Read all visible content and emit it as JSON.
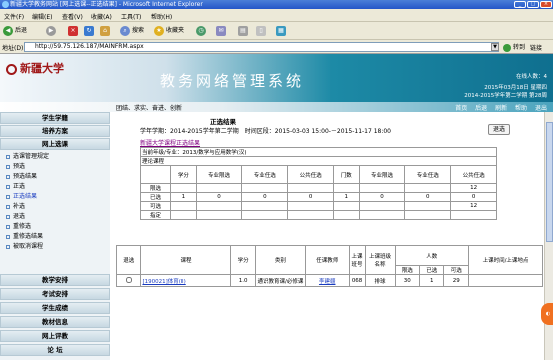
{
  "window": {
    "title": "新疆大学教务网站 [网上选课--正选结果] - Microsoft Internet Explorer"
  },
  "menu": [
    "文件(F)",
    "编辑(E)",
    "查看(V)",
    "收藏(A)",
    "工具(T)",
    "帮助(H)"
  ],
  "toolbar": {
    "back": "后退",
    "search": "搜索",
    "favorites": "收藏夹"
  },
  "address": {
    "label": "地址(D)",
    "url": "http://59.75.126.187/MAINFRM.aspx",
    "go": "转到",
    "links": "链接"
  },
  "banner": {
    "school": "新疆大学",
    "system_title": "教务网络管理系统",
    "online": "在线人数：4",
    "date": "2015年03月18日 星期四",
    "term": "2014-2015学年第二学期 第28周"
  },
  "slogan": "团结、求实、奋进、创新",
  "nav": [
    "首页",
    "后退",
    "刷新",
    "帮助",
    "退出"
  ],
  "sidebar": {
    "sections": [
      "学生学籍",
      "培养方案",
      "网上选课",
      "教学安排",
      "考试安排",
      "学生成绩",
      "教材信息",
      "网上评教",
      "论  坛"
    ],
    "items": [
      "选课管理规定",
      "预选",
      "预选结果",
      "正选",
      "正选结果",
      "补选",
      "退选",
      "重修选",
      "重修选结果",
      "被取消课程"
    ]
  },
  "main": {
    "heading": "正选结果",
    "term_line": "学年学期：2014-2015学年第二学期　时间区段：2015-03-03 15:00-－2015-11-17 18:00",
    "close_btn": "退选",
    "link": "新疆大学课程正选结果",
    "grade_line": "当前年级/专业：2013/数学与应用数学(汉)",
    "theory": "理论课程",
    "summary_headers": [
      "学分",
      "专业限选",
      "专业任选",
      "公共任选",
      "门数",
      "专业限选",
      "专业任选",
      "公共任选"
    ],
    "summary_rows": [
      {
        "label": "限选",
        "vals": [
          "",
          "",
          "",
          "",
          "",
          "",
          "",
          "12"
        ]
      },
      {
        "label": "已选",
        "vals": [
          "1",
          "0",
          "0",
          "0",
          "1",
          "0",
          "0",
          "0"
        ]
      },
      {
        "label": "可选",
        "vals": [
          "",
          "",
          "",
          "",
          "",
          "",
          "",
          "12"
        ]
      },
      {
        "label": "指定",
        "vals": [
          "",
          "",
          "",
          "",
          "",
          "",
          "",
          ""
        ]
      }
    ],
    "course_headers": [
      "退选",
      "课程",
      "学分",
      "类别",
      "任课教师",
      "上课班号",
      "上课班级名称",
      "限选",
      "已选",
      "可选",
      "上课时间/上课地点"
    ],
    "capacity_header": "人数",
    "courses": [
      {
        "code": "[190021]体育(Ⅱ)",
        "credit": "1.0",
        "type": "通识教育课/必修课",
        "teacher": "李建疆",
        "class_no": "068",
        "class_name": "排球",
        "limit": "30",
        "selected": "1",
        "available": "29",
        "time": ""
      }
    ]
  }
}
